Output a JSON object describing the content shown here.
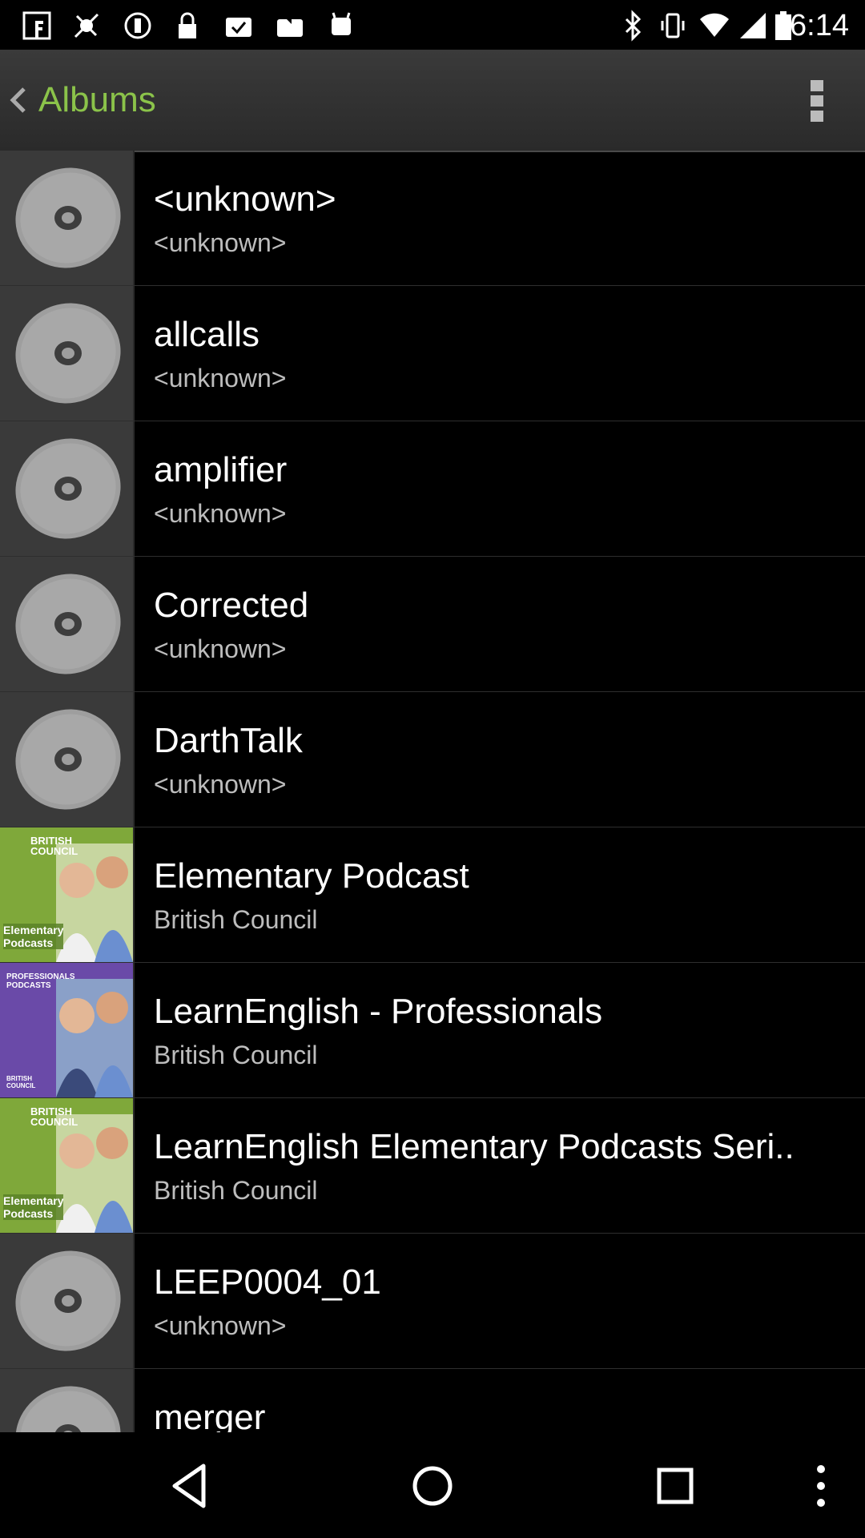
{
  "status_bar": {
    "time": "6:14",
    "left_icons": [
      "facebook-icon",
      "fake-gps-icon",
      "do-not-disturb-icon",
      "lock-icon",
      "task-check-icon",
      "briefcase-icon",
      "android-debug-icon"
    ],
    "right_icons": [
      "bluetooth-icon",
      "vibrate-icon",
      "wifi-icon",
      "signal-icon",
      "battery-icon"
    ]
  },
  "action_bar": {
    "title": "Albums",
    "accent_color": "#8bc34a"
  },
  "albums": [
    {
      "title": "<unknown>",
      "artist": "<unknown>",
      "art": "generic-disc"
    },
    {
      "title": "allcalls",
      "artist": "<unknown>",
      "art": "generic-disc"
    },
    {
      "title": "amplifier",
      "artist": "<unknown>",
      "art": "generic-disc"
    },
    {
      "title": "Corrected",
      "artist": "<unknown>",
      "art": "generic-disc"
    },
    {
      "title": "DarthTalk",
      "artist": "<unknown>",
      "art": "generic-disc"
    },
    {
      "title": "Elementary Podcast",
      "artist": "British Council",
      "art": "british-council-elementary",
      "art_text": {
        "brand": "BRITISH\nCOUNCIL",
        "caption": "Elementary\nPodcasts"
      }
    },
    {
      "title": "LearnEnglish - Professionals",
      "artist": "British Council",
      "art": "british-council-professionals",
      "art_text": {
        "brand": "BRITISH\nCOUNCIL",
        "caption": "PROFESSIONALS\nPODCASTS"
      }
    },
    {
      "title": "LearnEnglish Elementary Podcasts Seri..",
      "artist": "British Council",
      "art": "british-council-elementary",
      "art_text": {
        "brand": "BRITISH\nCOUNCIL",
        "caption": "Elementary\nPodcasts"
      }
    },
    {
      "title": "LEEP0004_01",
      "artist": "<unknown>",
      "art": "generic-disc"
    },
    {
      "title": "merger",
      "artist": "",
      "art": "generic-disc"
    }
  ],
  "nav_bar": {
    "buttons": [
      "back-icon",
      "home-icon",
      "recents-icon",
      "menu-icon"
    ]
  }
}
